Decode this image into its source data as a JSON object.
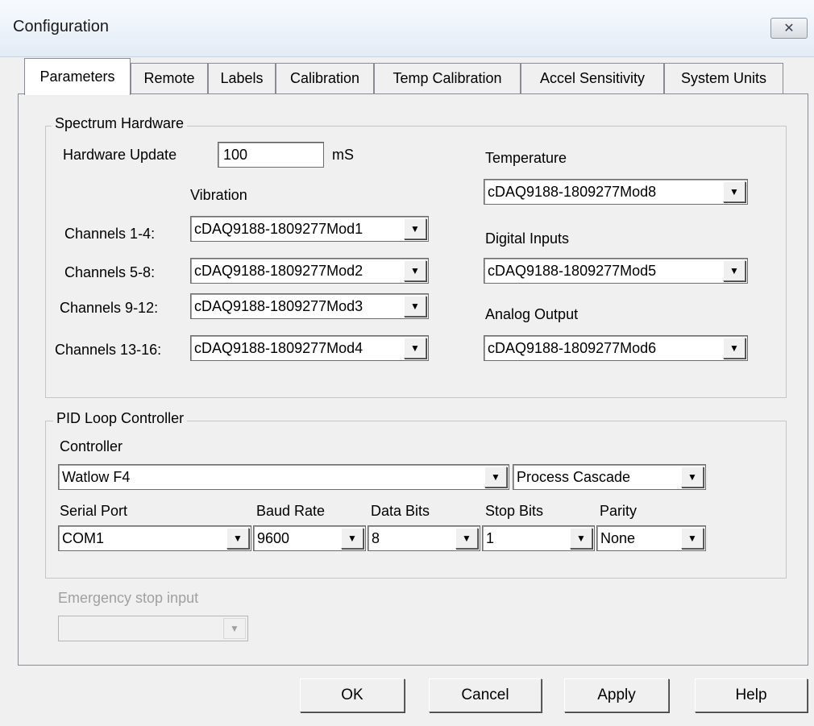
{
  "window": {
    "title": "Configuration",
    "close_icon": "close-icon"
  },
  "tabs": [
    {
      "label": "Parameters",
      "active": true
    },
    {
      "label": "Remote"
    },
    {
      "label": "Labels"
    },
    {
      "label": "Calibration"
    },
    {
      "label": "Temp Calibration"
    },
    {
      "label": "Accel Sensitivity"
    },
    {
      "label": "System Units"
    }
  ],
  "spectrum_hardware": {
    "group_label": "Spectrum Hardware",
    "hardware_update_label": "Hardware Update",
    "hardware_update_value": "100",
    "hardware_update_unit": "mS",
    "vibration_label": "Vibration",
    "channels": [
      {
        "label": "Channels 1-4:",
        "value": "cDAQ9188-1809277Mod1"
      },
      {
        "label": "Channels 5-8:",
        "value": "cDAQ9188-1809277Mod2"
      },
      {
        "label": "Channels 9-12:",
        "value": "cDAQ9188-1809277Mod3"
      },
      {
        "label": "Channels 13-16:",
        "value": "cDAQ9188-1809277Mod4"
      }
    ],
    "temperature_label": "Temperature",
    "temperature_value": "cDAQ9188-1809277Mod8",
    "digital_inputs_label": "Digital Inputs",
    "digital_inputs_value": "cDAQ9188-1809277Mod5",
    "analog_output_label": "Analog Output",
    "analog_output_value": "cDAQ9188-1809277Mod6"
  },
  "pid": {
    "group_label": "PID Loop Controller",
    "controller_label": "Controller",
    "controller_value": "Watlow F4",
    "mode_value": "Process Cascade",
    "serial_port_label": "Serial Port",
    "serial_port_value": "COM1",
    "baud_rate_label": "Baud Rate",
    "baud_rate_value": "9600",
    "data_bits_label": "Data Bits",
    "data_bits_value": "8",
    "stop_bits_label": "Stop Bits",
    "stop_bits_value": "1",
    "parity_label": "Parity",
    "parity_value": "None"
  },
  "emergency": {
    "label": "Emergency stop input",
    "value": ""
  },
  "buttons": {
    "ok": "OK",
    "cancel": "Cancel",
    "apply": "Apply",
    "help": "Help"
  }
}
